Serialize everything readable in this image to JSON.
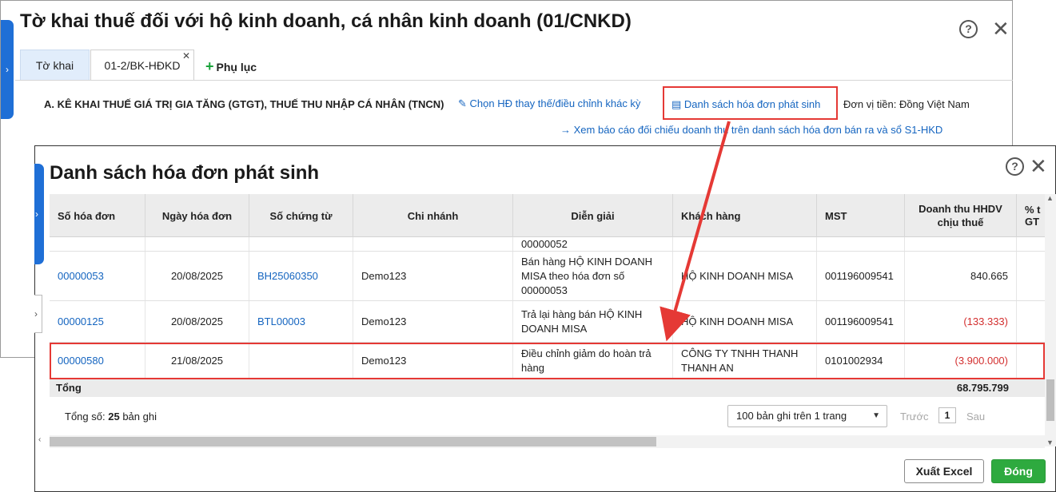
{
  "back_window": {
    "title": "Tờ khai thuế đối với hộ kinh doanh, cá nhân kinh doanh (01/CNKD)",
    "tabs": [
      {
        "label": "Tờ khai"
      },
      {
        "label": "01-2/BK-HĐKD"
      }
    ],
    "add_appendix_label": "Phụ lục",
    "section_title": "A. KÊ KHAI THUẾ GIÁ TRỊ GIA TĂNG (GTGT), THUẾ THU NHẬP CÁ NHÂN (TNCN)",
    "link_replace": "Chọn HĐ thay thế/điều chỉnh khác kỳ",
    "link_invoice_list": "Danh sách hóa đơn phát sinh",
    "currency": "Đơn vị tiền: Đồng Việt Nam",
    "link_report": "Xem báo cáo đối chiếu doanh thu trên danh sách hóa đơn bán ra và sổ S1-HKD"
  },
  "dialog": {
    "title": "Danh sách hóa đơn phát sinh",
    "columns": {
      "invoice_no": "Số hóa đơn",
      "invoice_date": "Ngày hóa đơn",
      "voucher_no": "Số chứng từ",
      "branch": "Chi nhánh",
      "description": "Diễn giải",
      "customer": "Khách hàng",
      "tax_code": "MST",
      "revenue": "Doanh thu HHDV chịu thuế",
      "percent": "% t GT"
    },
    "rows": [
      {
        "invoice_no": "",
        "invoice_date": "",
        "voucher_no": "",
        "branch": "",
        "description": "00000052",
        "customer": "",
        "tax_code": "",
        "revenue": ""
      },
      {
        "invoice_no": "00000053",
        "invoice_date": "20/08/2025",
        "voucher_no": "BH25060350",
        "branch": "Demo123",
        "description": "Bán hàng HỘ KINH DOANH MISA theo hóa đơn số 00000053",
        "customer": "HỘ KINH DOANH MISA",
        "tax_code": "001196009541",
        "revenue": "840.665"
      },
      {
        "invoice_no": "00000125",
        "invoice_date": "20/08/2025",
        "voucher_no": "BTL00003",
        "branch": "Demo123",
        "description": "Trả lại hàng bán HỘ KINH DOANH MISA",
        "customer": "HỘ KINH DOANH MISA",
        "tax_code": "001196009541",
        "revenue": "(133.333)"
      },
      {
        "invoice_no": "00000580",
        "invoice_date": "21/08/2025",
        "voucher_no": "",
        "branch": "Demo123",
        "description": "Điều chỉnh giảm do hoàn trả hàng",
        "customer": "CÔNG TY TNHH THANH THANH AN",
        "tax_code": "0101002934",
        "revenue": "(3.900.000)"
      }
    ],
    "total_label": "Tổng",
    "total_revenue": "68.795.799",
    "record_count_label": "Tổng số:",
    "record_count": "25",
    "record_count_suffix": "bản ghi",
    "page_size_option": "100 bản ghi trên 1 trang",
    "prev_label": "Trước",
    "current_page": "1",
    "next_label": "Sau",
    "export_button": "Xuất Excel",
    "close_button": "Đóng"
  },
  "colors": {
    "accent_blue": "#1f6fd6",
    "link_blue": "#1565c0",
    "highlight_red": "#e53935",
    "negative_red": "#d32f2f",
    "primary_green": "#2eaa3f"
  }
}
